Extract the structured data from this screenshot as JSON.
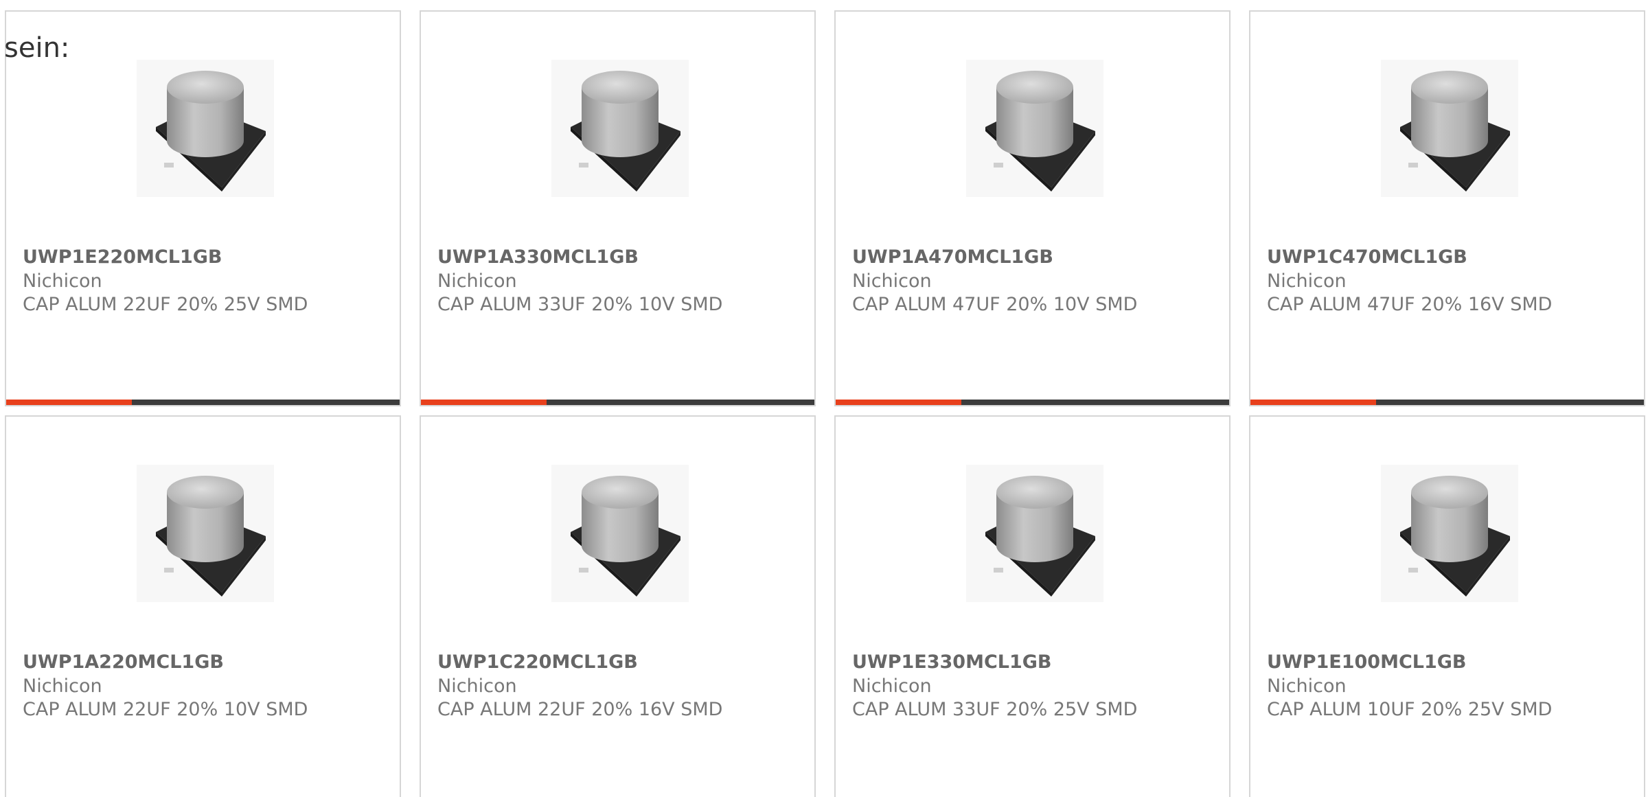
{
  "intro": {
    "text": "sein:"
  },
  "colors": {
    "accent": "#e8401c",
    "bar": "#3c3c3c",
    "border": "#d6d6d6",
    "part_text": "#666666",
    "body_text": "#777777"
  },
  "products": [
    {
      "part": "UWP1E220MCL1GB",
      "brand": "Nichicon",
      "desc": "CAP ALUM 22UF 20% 25V SMD",
      "image": "smd-aluminum-capacitor"
    },
    {
      "part": "UWP1A330MCL1GB",
      "brand": "Nichicon",
      "desc": "CAP ALUM 33UF 20% 10V SMD",
      "image": "smd-aluminum-capacitor"
    },
    {
      "part": "UWP1A470MCL1GB",
      "brand": "Nichicon",
      "desc": "CAP ALUM 47UF 20% 10V SMD",
      "image": "smd-aluminum-capacitor"
    },
    {
      "part": "UWP1C470MCL1GB",
      "brand": "Nichicon",
      "desc": "CAP ALUM 47UF 20% 16V SMD",
      "image": "smd-aluminum-capacitor"
    },
    {
      "part": "UWP1A220MCL1GB",
      "brand": "Nichicon",
      "desc": "CAP ALUM 22UF 20% 10V SMD",
      "image": "smd-aluminum-capacitor"
    },
    {
      "part": "UWP1C220MCL1GB",
      "brand": "Nichicon",
      "desc": "CAP ALUM 22UF 20% 16V SMD",
      "image": "smd-aluminum-capacitor"
    },
    {
      "part": "UWP1E330MCL1GB",
      "brand": "Nichicon",
      "desc": "CAP ALUM 33UF 20% 25V SMD",
      "image": "smd-aluminum-capacitor"
    },
    {
      "part": "UWP1E100MCL1GB",
      "brand": "Nichicon",
      "desc": "CAP ALUM 10UF 20% 25V SMD",
      "image": "smd-aluminum-capacitor"
    }
  ]
}
